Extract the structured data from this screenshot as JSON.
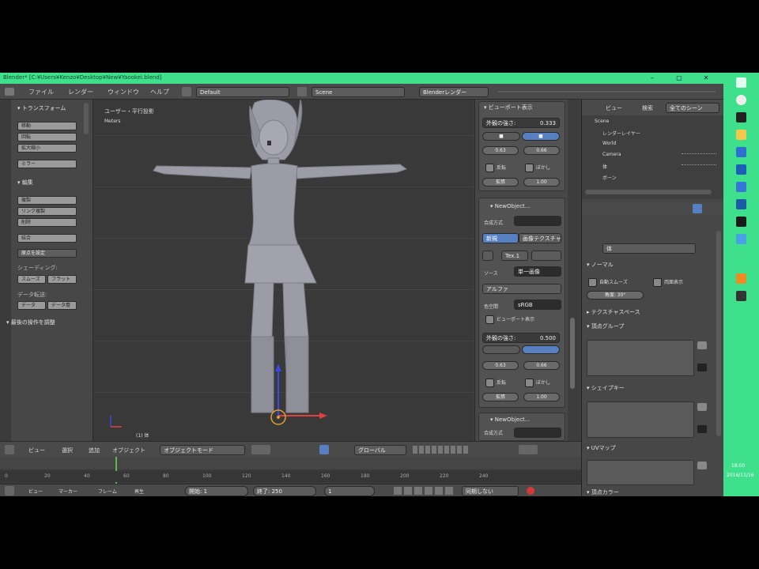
{
  "window": {
    "title": "Blender* [C:¥Users¥Kenzo¥Desktop¥New¥Yaookei.blend]",
    "min": "–",
    "max": "▢",
    "close": "✕"
  },
  "menubar": {
    "items": [
      "ファイル",
      "レンダー",
      "ウィンドウ",
      "ヘルプ"
    ],
    "layout": "Default",
    "scene": "Scene",
    "engine": "Blenderレンダー"
  },
  "toolshelf": {
    "transform_header": "▾ トランスフォーム",
    "transform_buttons": [
      "移動",
      "回転",
      "拡大縮小",
      "ミラー"
    ],
    "edit_header": "▾ 編集",
    "edit_buttons": [
      "複製",
      "リンク複製",
      "削除",
      "結合"
    ],
    "origin_button": "原点を設定",
    "shading_header": "シェーディング:",
    "smooth_label": "スムーズ",
    "flat_label": "フラット",
    "data_transfer_header": "データ転送:",
    "data_label": "データ",
    "data_layout_label": "データ層",
    "history_header": "▾ 最後の操作を調整"
  },
  "viewport": {
    "view_label": "ユーザー・平行投影",
    "units_label": "Meters",
    "object_label": "(1) 体"
  },
  "npanel": {
    "section1_header": "▾ ビューポート表示",
    "size_label": "外観の強さ:",
    "size_value": "0.333",
    "color_a": "■",
    "color_b": "■",
    "value_a": "0.63",
    "value_b": "0.66",
    "toggle_a": "反転",
    "toggle_b": "ぼかし",
    "toggle_c": "拡張",
    "toggle_d": "1.00",
    "section2_header": "▾ NewObject...",
    "mode_label": "合成方式",
    "new_label": "新規",
    "image_label": "画像テクスチャ",
    "slot_label": "Tex.1",
    "source_label": "ソース",
    "source_value": "単一画像",
    "alpha_label": "アルファ",
    "format_label": "色空間",
    "format_value": "sRGB",
    "view_as_render": "ビューポート表示",
    "size2_label": "外観の強さ:",
    "size2_value": "0.500",
    "value_c": "0.63",
    "value_d": "0.66",
    "toggle_e": "反転",
    "toggle_f": "ぼかし",
    "toggle_g": "拡張",
    "toggle_h": "1.00",
    "section3_header": "▾ NewObject...",
    "mode2_label": "合成方式"
  },
  "outliner": {
    "tabs": [
      "ビュー",
      "検索",
      "全てのシーン"
    ],
    "items": [
      "Scene",
      "レンダーレイヤー",
      "World",
      "Camera",
      "体",
      "ボーン"
    ]
  },
  "properties": {
    "object_name": "体",
    "normal_header": "▾ ノーマル",
    "auto_smooth": "自動スムーズ",
    "double_sided": "両面表示",
    "angle_label": "角度:",
    "angle_value": "30°",
    "texture_space_header": "▸ テクスチャスペース",
    "vertex_groups_header": "▾ 頂点グループ",
    "shape_keys_header": "▾ シェイプキー",
    "uv_maps_header": "▾ UVマップ",
    "vertex_colors_header": "▾ 頂点カラー"
  },
  "vpheader": {
    "menus": [
      "ビュー",
      "選択",
      "追加",
      "オブジェクト"
    ],
    "mode": "オブジェクトモード",
    "pivot": "グローバル"
  },
  "timeline": {
    "ticks": [
      "0",
      "20",
      "40",
      "60",
      "80",
      "100",
      "120",
      "140",
      "160",
      "180",
      "200",
      "220",
      "240"
    ],
    "menus": [
      "ビュー",
      "マーカー",
      "フレーム",
      "再生"
    ],
    "start_label": "開始:",
    "start_value": "1",
    "end_label": "終了:",
    "end_value": "250",
    "current": "1",
    "sync": "同期しない"
  },
  "taskbar": {
    "clock_time": "18:00",
    "clock_date": "2016/11/16"
  }
}
